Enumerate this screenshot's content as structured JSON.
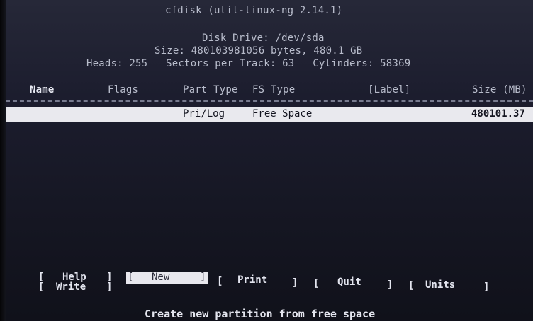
{
  "header": {
    "title": "cfdisk (util-linux-ng 2.14.1)",
    "disk_drive": "Disk Drive: /dev/sda",
    "size": "Size: 480103981056 bytes, 480.1 GB",
    "geometry": "Heads: 255   Sectors per Track: 63   Cylinders: 58369"
  },
  "table": {
    "columns": [
      "Name",
      "Flags",
      "Part Type",
      "FS Type",
      "[Label]",
      "Size (MB)"
    ],
    "rows": [
      {
        "part_type": "Pri/Log",
        "fs_type": "Free Space",
        "size": "480101.37"
      }
    ]
  },
  "menu": {
    "items": [
      {
        "label": "Help"
      },
      {
        "label": "New",
        "selected": true
      },
      {
        "label": "Print"
      },
      {
        "label": "Quit"
      },
      {
        "label": "Units"
      },
      {
        "label": "Write"
      }
    ]
  },
  "status": "Create new partition from free space",
  "colors": {
    "background": "#1c1d2e",
    "text": "#c9ccd9",
    "highlight": "#e9e9ee"
  }
}
